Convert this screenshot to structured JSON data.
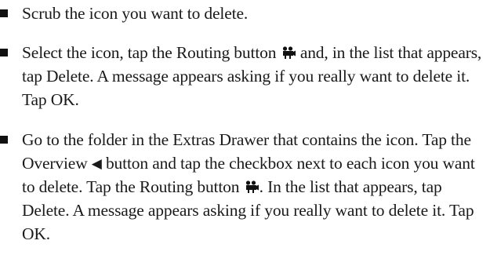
{
  "bullets": [
    {
      "text": "Scrub the icon you want to delete."
    },
    {
      "before": "Select the icon, tap the Routing button ",
      "icon": "routing-icon",
      "after": " and, in the list that appears, tap Delete. A message appears asking if you really want to delete it. Tap OK."
    },
    {
      "part1": "Go to the folder in the Extras Drawer that contains the icon. Tap the Overview ",
      "icon1": "overview-icon",
      "glyph1": "◀",
      "part2": " button and tap the checkbox next to each icon you want to delete. Tap the Routing button ",
      "icon2": "routing-icon",
      "part3": ". In the list that appears, tap Delete. A message appears asking if you really want to delete it. Tap OK."
    }
  ]
}
